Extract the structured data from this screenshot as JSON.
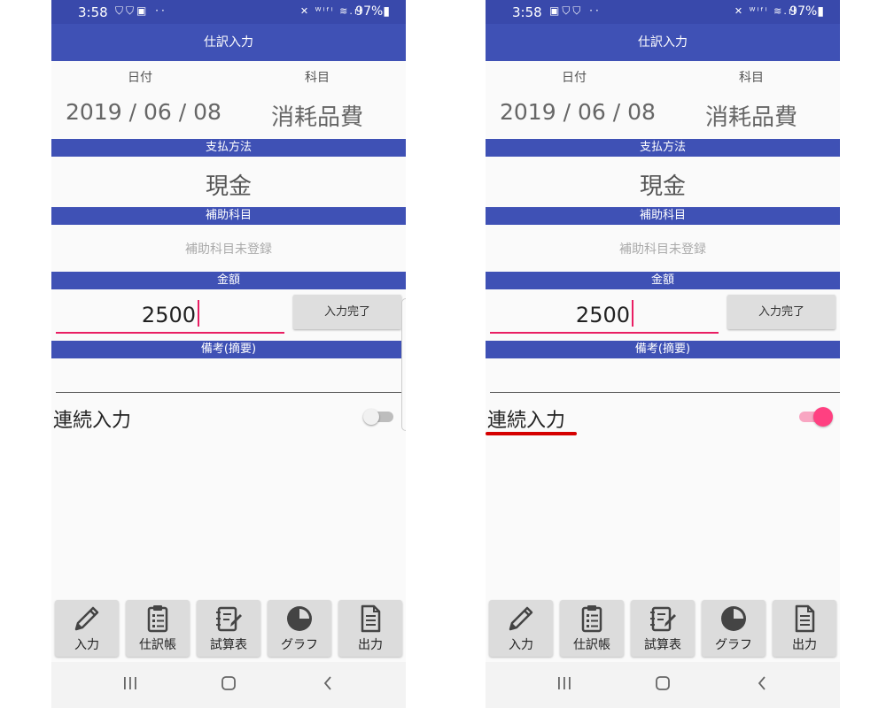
{
  "screens": [
    {
      "status": {
        "time": "3:58",
        "left_icons": "⛉⛉▣ ··",
        "right_icons": "✕ ᵂⁱᶠⁱ ≋.ıl",
        "battery": "97%▮"
      },
      "app_bar_title": "仕訳入力",
      "date_label": "日付",
      "account_label": "科目",
      "date_value": "2019 / 06 / 08",
      "account_value": "消耗品費",
      "payment_header": "支払方法",
      "payment_value": "現金",
      "subaccount_header": "補助科目",
      "subaccount_value": "補助科目未登録",
      "amount_header": "金額",
      "amount_value": "2500",
      "complete_button": "入力完了",
      "memo_header": "備考(摘要)",
      "memo_value": "",
      "continuous_label": "連続入力",
      "continuous_on": false,
      "nav": [
        "入力",
        "仕訳帳",
        "試算表",
        "グラフ",
        "出力"
      ]
    },
    {
      "status": {
        "time": "3:58",
        "left_icons": "▣⛉⛉ ··",
        "right_icons": "✕ ᵂⁱᶠⁱ ≋.ıl",
        "battery": "97%▮"
      },
      "app_bar_title": "仕訳入力",
      "date_label": "日付",
      "account_label": "科目",
      "date_value": "2019 / 06 / 08",
      "account_value": "消耗品費",
      "payment_header": "支払方法",
      "payment_value": "現金",
      "subaccount_header": "補助科目",
      "subaccount_value": "補助科目未登録",
      "amount_header": "金額",
      "amount_value": "2500",
      "complete_button": "入力完了",
      "memo_header": "備考(摘要)",
      "memo_value": "",
      "continuous_label": "連続入力",
      "continuous_on": true,
      "nav": [
        "入力",
        "仕訳帳",
        "試算表",
        "グラフ",
        "出力"
      ]
    }
  ],
  "colors": {
    "primary": "#3f51b5",
    "status_bar": "#3949ab",
    "accent": "#ff4081",
    "highlight": "#d50000"
  },
  "icons": {
    "nav": [
      "pencil-icon",
      "clipboard-list-icon",
      "ledger-edit-icon",
      "pie-chart-icon",
      "document-icon"
    ],
    "system": [
      "recent-apps-icon",
      "home-icon",
      "back-icon"
    ]
  }
}
